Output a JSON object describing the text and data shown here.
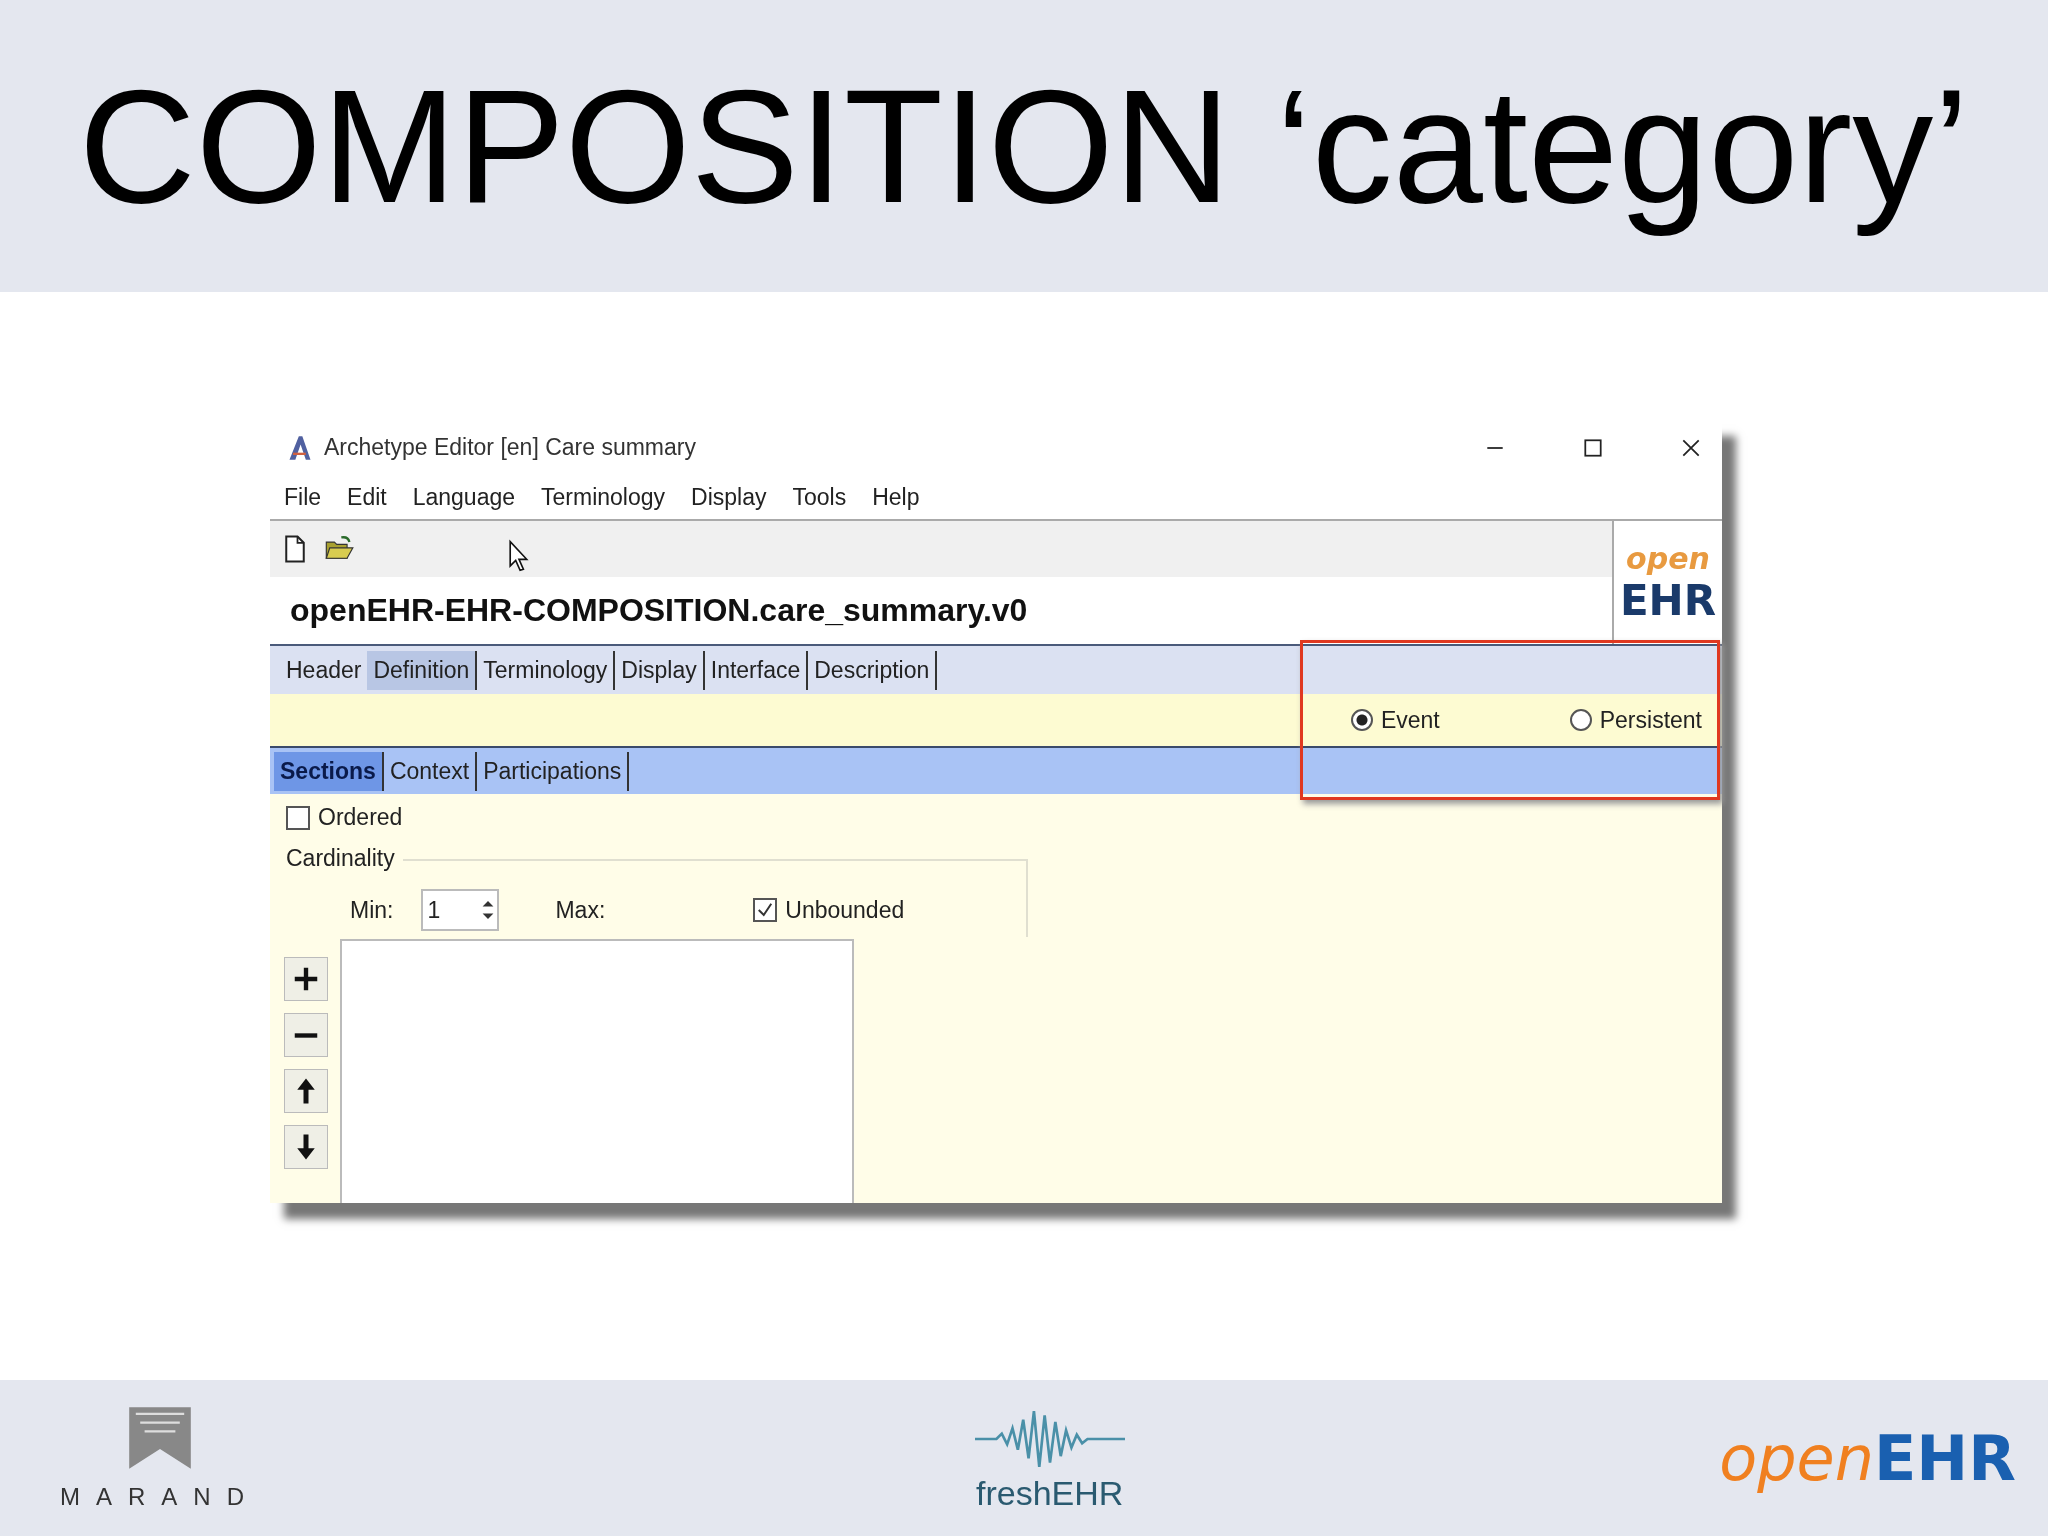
{
  "slide_title": "COMPOSITION ‘category’",
  "window": {
    "title": "Archetype Editor [en] Care summary",
    "menu": [
      "File",
      "Edit",
      "Language",
      "Terminology",
      "Display",
      "Tools",
      "Help"
    ],
    "archetype_id": "openEHR-EHR-COMPOSITION.care_summary.v0",
    "logo": {
      "top": "open",
      "bottom": "EHR"
    }
  },
  "tabs": [
    {
      "label": "Header",
      "selected": false
    },
    {
      "label": "Definition",
      "selected": true
    },
    {
      "label": "Terminology",
      "selected": false
    },
    {
      "label": "Display",
      "selected": false
    },
    {
      "label": "Interface",
      "selected": false
    },
    {
      "label": "Description",
      "selected": false
    }
  ],
  "category": [
    {
      "label": "Event",
      "selected": true
    },
    {
      "label": "Persistent",
      "selected": false
    }
  ],
  "sub_tabs": [
    {
      "label": "Sections",
      "selected": true
    },
    {
      "label": "Context",
      "selected": false
    },
    {
      "label": "Participations",
      "selected": false
    }
  ],
  "ordered": {
    "label": "Ordered",
    "checked": false
  },
  "cardinality": {
    "title": "Cardinality",
    "min_label": "Min:",
    "min_value": "1",
    "max_label": "Max:",
    "unbounded": {
      "label": "Unbounded",
      "checked": true
    }
  },
  "footer": {
    "left_logo": "MARAND",
    "center_logo": "freshEHR",
    "right_logo": {
      "part1": "open",
      "part2": "EHR"
    }
  }
}
